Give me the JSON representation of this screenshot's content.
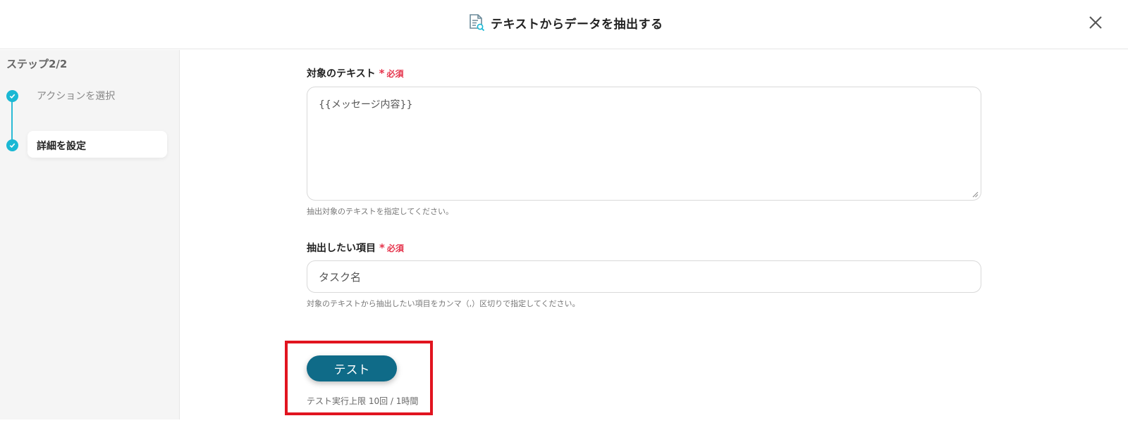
{
  "header": {
    "title": "テキストからデータを抽出する",
    "icon": "document-search-icon",
    "close_icon": "close-icon"
  },
  "sidebar": {
    "step_title": "ステップ2/2",
    "steps": [
      {
        "label": "アクションを選択",
        "status": "completed"
      },
      {
        "label": "詳細を設定",
        "status": "active"
      }
    ]
  },
  "form": {
    "required_label": "必須",
    "target_text": {
      "label": "対象のテキスト",
      "value": "{{メッセージ内容}}",
      "help": "抽出対象のテキストを指定してください。"
    },
    "extract_items": {
      "label": "抽出したい項目",
      "value": "タスク名",
      "help": "対象のテキストから抽出したい項目をカンマ（,）区切りで指定してください。"
    }
  },
  "test": {
    "button_label": "テスト",
    "limit_text": "テスト実行上限 10回 / 1時間"
  },
  "colors": {
    "accent": "#1ab8d4",
    "button": "#0f6b88",
    "required": "#e5334b",
    "highlight": "#e1141f"
  }
}
